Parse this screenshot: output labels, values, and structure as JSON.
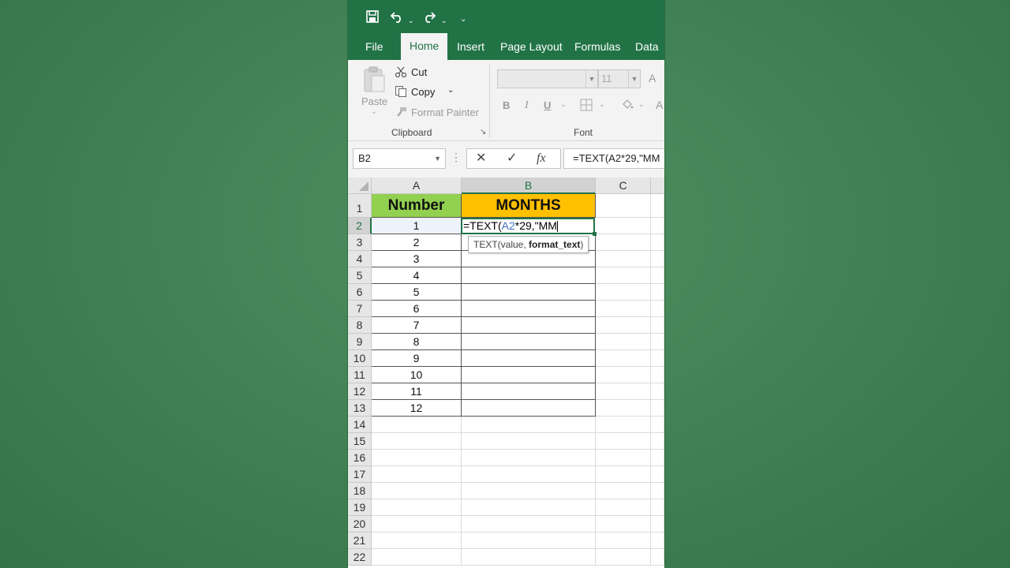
{
  "quick_access": {
    "save_icon": "save-icon",
    "undo_icon": "undo-icon",
    "redo_icon": "redo-icon"
  },
  "tabs": [
    {
      "label": "File"
    },
    {
      "label": "Home"
    },
    {
      "label": "Insert"
    },
    {
      "label": "Page Layout"
    },
    {
      "label": "Formulas"
    },
    {
      "label": "Data"
    }
  ],
  "active_tab": "Home",
  "clipboard": {
    "paste_label": "Paste",
    "cut_label": "Cut",
    "copy_label": "Copy",
    "format_painter_label": "Format Painter",
    "group_label": "Clipboard"
  },
  "font": {
    "font_size": "11",
    "bold": "B",
    "italic": "I",
    "underline": "U",
    "increase_size": "A",
    "font_color": "A",
    "group_label": "Font"
  },
  "formula_bar": {
    "name_box": "B2",
    "cancel": "✕",
    "enter": "✓",
    "fx": "fx",
    "formula": "=TEXT(A2*29,\"MM"
  },
  "columns": [
    "A",
    "B",
    "C"
  ],
  "selected_column": "B",
  "rows": [
    "1",
    "2",
    "3",
    "4",
    "5",
    "6",
    "7",
    "8",
    "9",
    "10",
    "11",
    "12",
    "13",
    "14",
    "15",
    "16",
    "17",
    "18",
    "19",
    "20",
    "21",
    "22"
  ],
  "selected_row": "2",
  "table": {
    "header_a": "Number",
    "header_b": "MONTHS",
    "numbers": [
      "1",
      "2",
      "3",
      "4",
      "5",
      "6",
      "7",
      "8",
      "9",
      "10",
      "11",
      "12"
    ]
  },
  "editing_cell": {
    "prefix": "=TEXT(",
    "ref": "A2",
    "suffix": "*29,\"MM",
    "ref_color": "#4472c4"
  },
  "tooltip": {
    "func": "TEXT(value, ",
    "arg": "format_text",
    "close": ")"
  },
  "colors": {
    "excel_green": "#217346",
    "header_a_fill": "#92d050",
    "header_b_fill": "#ffc000"
  }
}
